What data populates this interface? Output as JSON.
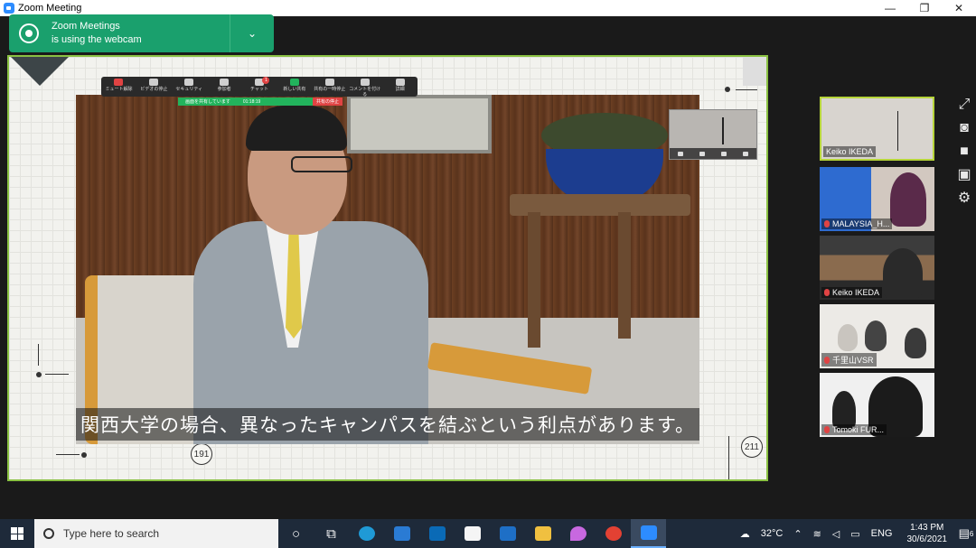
{
  "window": {
    "title": "Zoom Meeting",
    "minimize": "—",
    "maximize": "❐",
    "close": "✕"
  },
  "notification": {
    "line1": "Zoom Meetings",
    "line2": "is using the webcam",
    "chevron": "⌄"
  },
  "toolbar": {
    "items": [
      {
        "label": "ミュート解除",
        "icon": "mic-muted-icon"
      },
      {
        "label": "ビデオの停止",
        "icon": "video-camera-icon"
      },
      {
        "label": "セキュリティ",
        "icon": "shield-icon"
      },
      {
        "label": "参加者",
        "icon": "participants-icon",
        "count": "39"
      },
      {
        "label": "チャット",
        "icon": "chat-icon",
        "badge": "1"
      },
      {
        "label": "新しい共有",
        "icon": "share-screen-icon"
      },
      {
        "label": "共有の一時停止",
        "icon": "pause-icon"
      },
      {
        "label": "コメントを付ける",
        "icon": "annotate-icon"
      },
      {
        "label": "詳細",
        "icon": "more-icon"
      }
    ],
    "share_status": "画面を共有しています",
    "share_time": "01:18:19",
    "stop_share": "共有の停止"
  },
  "slide": {
    "subtitle": "関西大学の場合、異なったキャンパスを結ぶという利点があります。",
    "page_left": "191",
    "page_right": "211"
  },
  "participants": [
    {
      "name": "Keiko IKEDA",
      "muted": true,
      "active": true
    },
    {
      "name": "MALAYSIA_H...",
      "muted": true,
      "active": false
    },
    {
      "name": "Keiko IKEDA",
      "muted": true,
      "active": false
    },
    {
      "name": "千里山VSR",
      "muted": true,
      "active": false
    },
    {
      "name": "Tomoki FUR...",
      "muted": true,
      "active": false
    }
  ],
  "side_icons": [
    "pin-icon",
    "camera-icon",
    "video-icon",
    "gallery-icon",
    "settings-icon"
  ],
  "taskbar": {
    "search_placeholder": "Type here to search",
    "weather": "32°C",
    "language": "ENG",
    "time": "1:43 PM",
    "date": "30/6/2021",
    "notif_count": "6"
  },
  "colors": {
    "accent_green": "#8ac142",
    "notification_green": "#1aa06d",
    "share_green": "#22b35c",
    "stop_red": "#e04343"
  }
}
